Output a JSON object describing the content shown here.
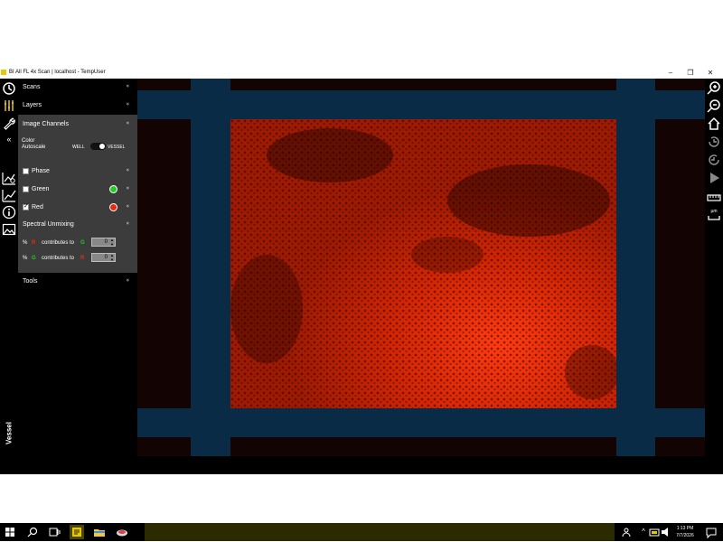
{
  "window": {
    "title": "BI All FL 4x Scan | localhost - TempUser"
  },
  "window_controls": {
    "minimize": "–",
    "maximize": "❐",
    "close": "✕"
  },
  "left_icons": [
    "clock-icon",
    "layers-icon",
    "wrench-icon",
    "collapse-icon",
    "chart-settings-icon",
    "chart-icon",
    "info-icon",
    "image-icon"
  ],
  "collapse_glyph": "«",
  "menu": {
    "scans": "Scans",
    "layers": "Layers",
    "image_channels": "Image Channels",
    "tools": "Tools"
  },
  "chevron_down": "»",
  "chevron_up": "«",
  "color_autoscale": {
    "label_line1": "Color",
    "label_line2": "Autoscale",
    "option_left": "WELL",
    "option_right": "VESSEL",
    "selected": "VESSEL"
  },
  "channels": [
    {
      "name": "Phase",
      "checked": false,
      "color": null
    },
    {
      "name": "Green",
      "checked": false,
      "color": "#22cc22"
    },
    {
      "name": "Red",
      "checked": true,
      "color": "#e82a10"
    }
  ],
  "spectral_unmixing": {
    "title": "Spectral Unmixing",
    "rows": [
      {
        "pct": "%",
        "from": "R",
        "text": "contributes to",
        "to": "G",
        "value": "0",
        "from_color": "#e82a10",
        "to_color": "#22cc22"
      },
      {
        "pct": "%",
        "from": "G",
        "text": "contributes to",
        "to": "R",
        "value": "0",
        "from_color": "#22cc22",
        "to_color": "#e82a10"
      }
    ]
  },
  "bottom_label": "Vessel",
  "right_tools": {
    "scale_unit": "µm",
    "icons": [
      "zoom-in-icon",
      "zoom-out-icon",
      "home-icon",
      "history-forward-icon",
      "history-back-icon",
      "play-icon",
      "ruler-icon",
      "scale-bar-icon"
    ]
  },
  "colors": {
    "well_plate_blue": "#0a2b46",
    "background_dark": "#140303",
    "fluorescence_red": "#e02a00",
    "panel_gray": "#3c3c3c"
  },
  "taskbar": {
    "time": "1:13 PM",
    "date": "7/7/2026",
    "icons": [
      "windows-start-icon",
      "search-icon",
      "task-view-icon",
      "app-active-icon",
      "file-explorer-icon",
      "app-icon"
    ]
  }
}
